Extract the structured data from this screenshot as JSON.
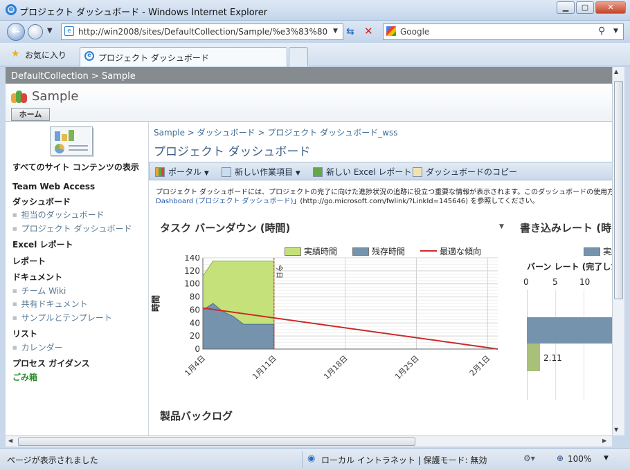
{
  "window": {
    "title": "プロジェクト ダッシュボード - Windows Internet Explorer"
  },
  "nav": {
    "address": "http://win2008/sites/DefaultCollection/Sample/%e3%83%80",
    "search_placeholder": "Google"
  },
  "favorites": {
    "favorites_label": "お気に入り",
    "tab_label": "プロジェクト ダッシュボード"
  },
  "site": {
    "breadcrumb": "DefaultCollection > Sample",
    "name": "Sample",
    "home_tab": "ホーム"
  },
  "leftnav": {
    "view_all": "すべてのサイト コンテンツの表示",
    "items": [
      {
        "kind": "head",
        "label": "Team Web Access"
      },
      {
        "kind": "head",
        "label": "ダッシュボード"
      },
      {
        "kind": "sub",
        "label": "担当のダッシュボード"
      },
      {
        "kind": "sub",
        "label": "プロジェクト ダッシュボード"
      },
      {
        "kind": "head",
        "label": "Excel レポート"
      },
      {
        "kind": "head",
        "label": "レポート"
      },
      {
        "kind": "head",
        "label": "ドキュメント"
      },
      {
        "kind": "sub",
        "label": "チーム Wiki"
      },
      {
        "kind": "sub",
        "label": "共有ドキュメント"
      },
      {
        "kind": "sub",
        "label": "サンプルとテンプレート"
      },
      {
        "kind": "head",
        "label": "リスト"
      },
      {
        "kind": "sub",
        "label": "カレンダー"
      },
      {
        "kind": "head",
        "label": "プロセス ガイダンス"
      },
      {
        "kind": "recycle",
        "label": "ごみ箱"
      }
    ]
  },
  "main": {
    "breadcrumb": "Sample > ダッシュボード > プロジェクト ダッシュボード_wss",
    "title": "プロジェクト ダッシュボード",
    "toolbar": {
      "portal": "ポータル",
      "new_work_item": "新しい作業項目",
      "new_excel_report": "新しい Excel レポート",
      "copy_dashboard": "ダッシュボードのコピー"
    },
    "description_line1": "プロジェクト ダッシュボードには、プロジェクトの完了に向けた進捗状況の追跡に役立つ重要な情報が表示されます。このダッシュボードの使用方",
    "description_link": "Dashboard (プロジェクト ダッシュボード)",
    "description_line2": "」(http://go.microsoft.com/fwlink/?LinkId=145646) を参照してください。",
    "backlog_title": "製品バックログ"
  },
  "burnrate": {
    "title": "書き込みレート (時",
    "legend": "実績",
    "subtitle": "バーン レート (完了した",
    "ticks": [
      "0",
      "5",
      "10"
    ],
    "value_label": "2.11"
  },
  "status": {
    "text": "ページが表示されました",
    "zone": "ローカル イントラネット | 保護モード: 無効",
    "zoom": "100%"
  },
  "colors": {
    "completed": "#c5e27a",
    "remaining": "#7593ad",
    "ideal": "#cc2a2a",
    "link": "#2659a8"
  },
  "chart_data": {
    "type": "area",
    "title": "タスク バーンダウン (時間)",
    "ylabel": "時間",
    "xlabel": "",
    "ylim": [
      0,
      140
    ],
    "yticks": [
      0,
      20,
      40,
      60,
      80,
      100,
      120,
      140
    ],
    "xtick_labels": [
      "1月4日",
      "1月11日",
      "1月18日",
      "1月25日",
      "2月1日"
    ],
    "today_label": "今日",
    "series": [
      {
        "name": "実績時間",
        "kind": "area",
        "points": [
          [
            0,
            112
          ],
          [
            1,
            135
          ],
          [
            2,
            135
          ],
          [
            3,
            135
          ],
          [
            4,
            135
          ],
          [
            5,
            135
          ],
          [
            6,
            135
          ],
          [
            7,
            135
          ]
        ]
      },
      {
        "name": "残存時間",
        "kind": "area",
        "points": [
          [
            0,
            60
          ],
          [
            1,
            70
          ],
          [
            2,
            57
          ],
          [
            3,
            50
          ],
          [
            4,
            38
          ],
          [
            5,
            38
          ],
          [
            6,
            38
          ],
          [
            7,
            38
          ]
        ]
      },
      {
        "name": "最適な傾向",
        "kind": "line",
        "points": [
          [
            0,
            63
          ],
          [
            29,
            0
          ]
        ]
      }
    ],
    "x_range": [
      0,
      29
    ],
    "today_x": 7
  }
}
